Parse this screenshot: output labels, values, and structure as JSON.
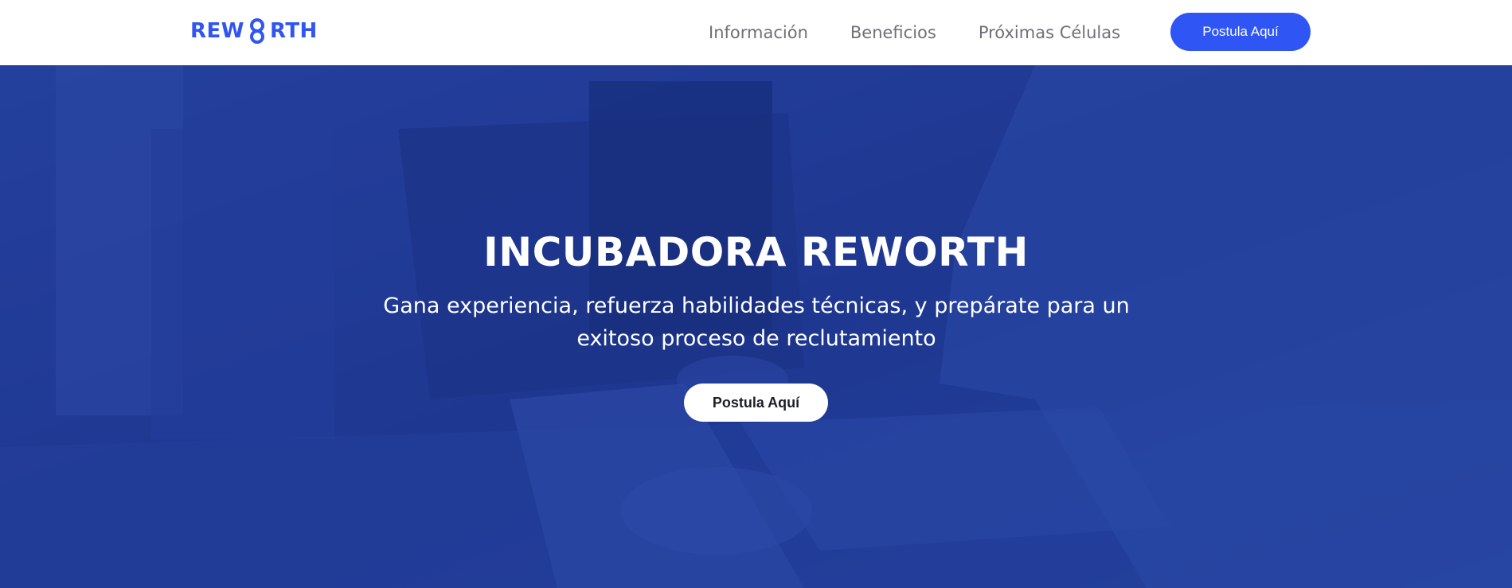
{
  "brand": {
    "logo_left": "REW",
    "logo_right": "RTH",
    "color": "#3055f0"
  },
  "nav": {
    "links": [
      "Información",
      "Beneficios",
      "Próximas Células"
    ],
    "cta": "Postula Aquí",
    "cta_color": "#2f56f5"
  },
  "hero": {
    "title": "INCUBADORA REWORTH",
    "subtitle": "Gana experiencia, refuerza habilidades técnicas, y prepárate para un exitoso proceso de reclutamiento",
    "cta": "Postula Aquí",
    "overlay_color": "#243d94"
  }
}
